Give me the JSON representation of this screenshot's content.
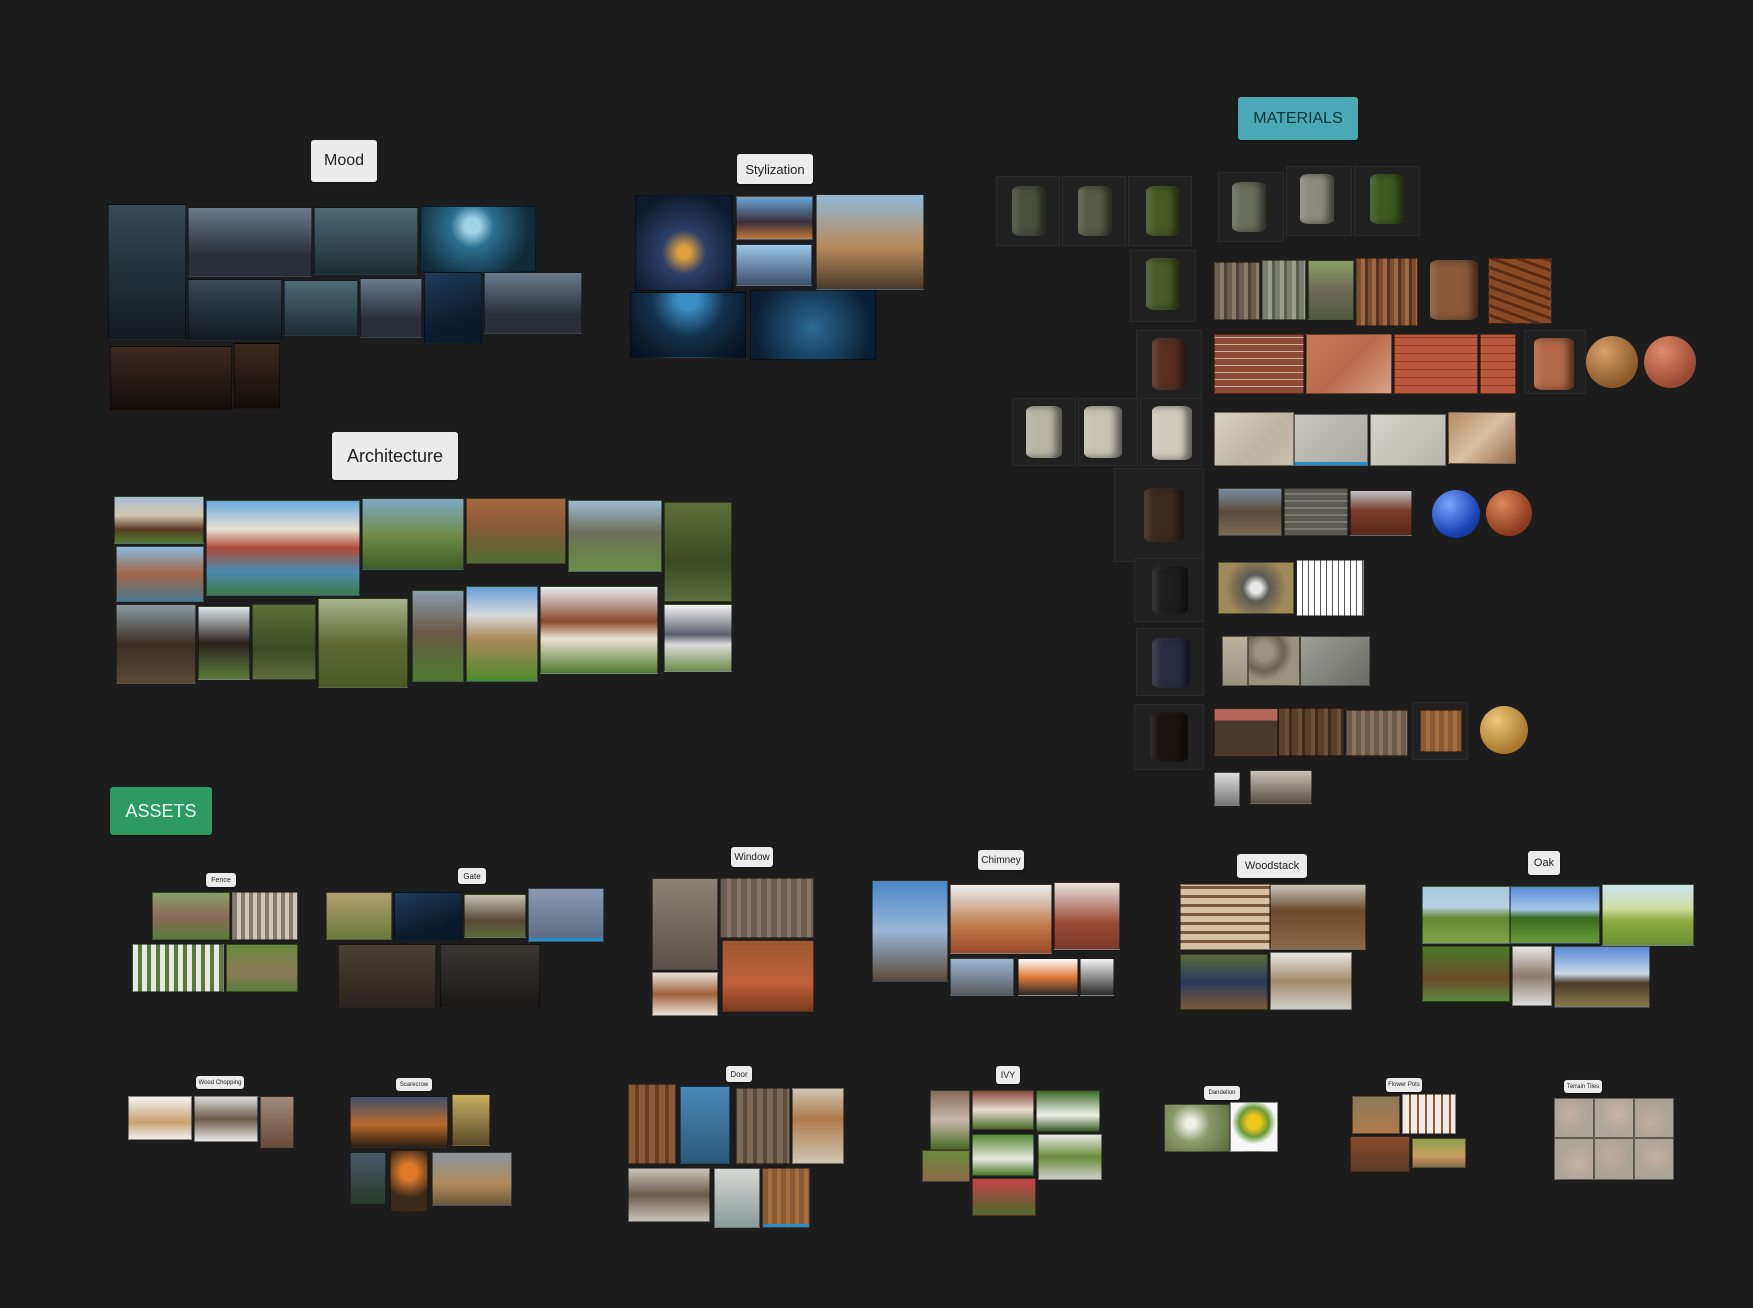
{
  "board": {
    "mood_label": "Mood",
    "stylization_label": "Stylization",
    "materials_label": "MATERIALS",
    "architecture_label": "Architecture",
    "assets_label": "ASSETS"
  },
  "assets": {
    "fence": "Fence",
    "gate": "Gate",
    "window": "Window",
    "chimney": "Chimney",
    "woodstack": "Woodstack",
    "oak": "Oak",
    "wood_chopping": "Wood Chopping",
    "scarecrow": "Scarecrow",
    "door": "Door",
    "ivy": "IVY",
    "dandelion": "Dandelion",
    "flower_pots": "Flower Pots",
    "terrain_tiles": "Terrain Tiles"
  },
  "colors": {
    "background": "#1c1c1c",
    "label_light": "#ececec",
    "materials_accent": "#4aa9b4",
    "assets_accent": "#2e9a63"
  }
}
